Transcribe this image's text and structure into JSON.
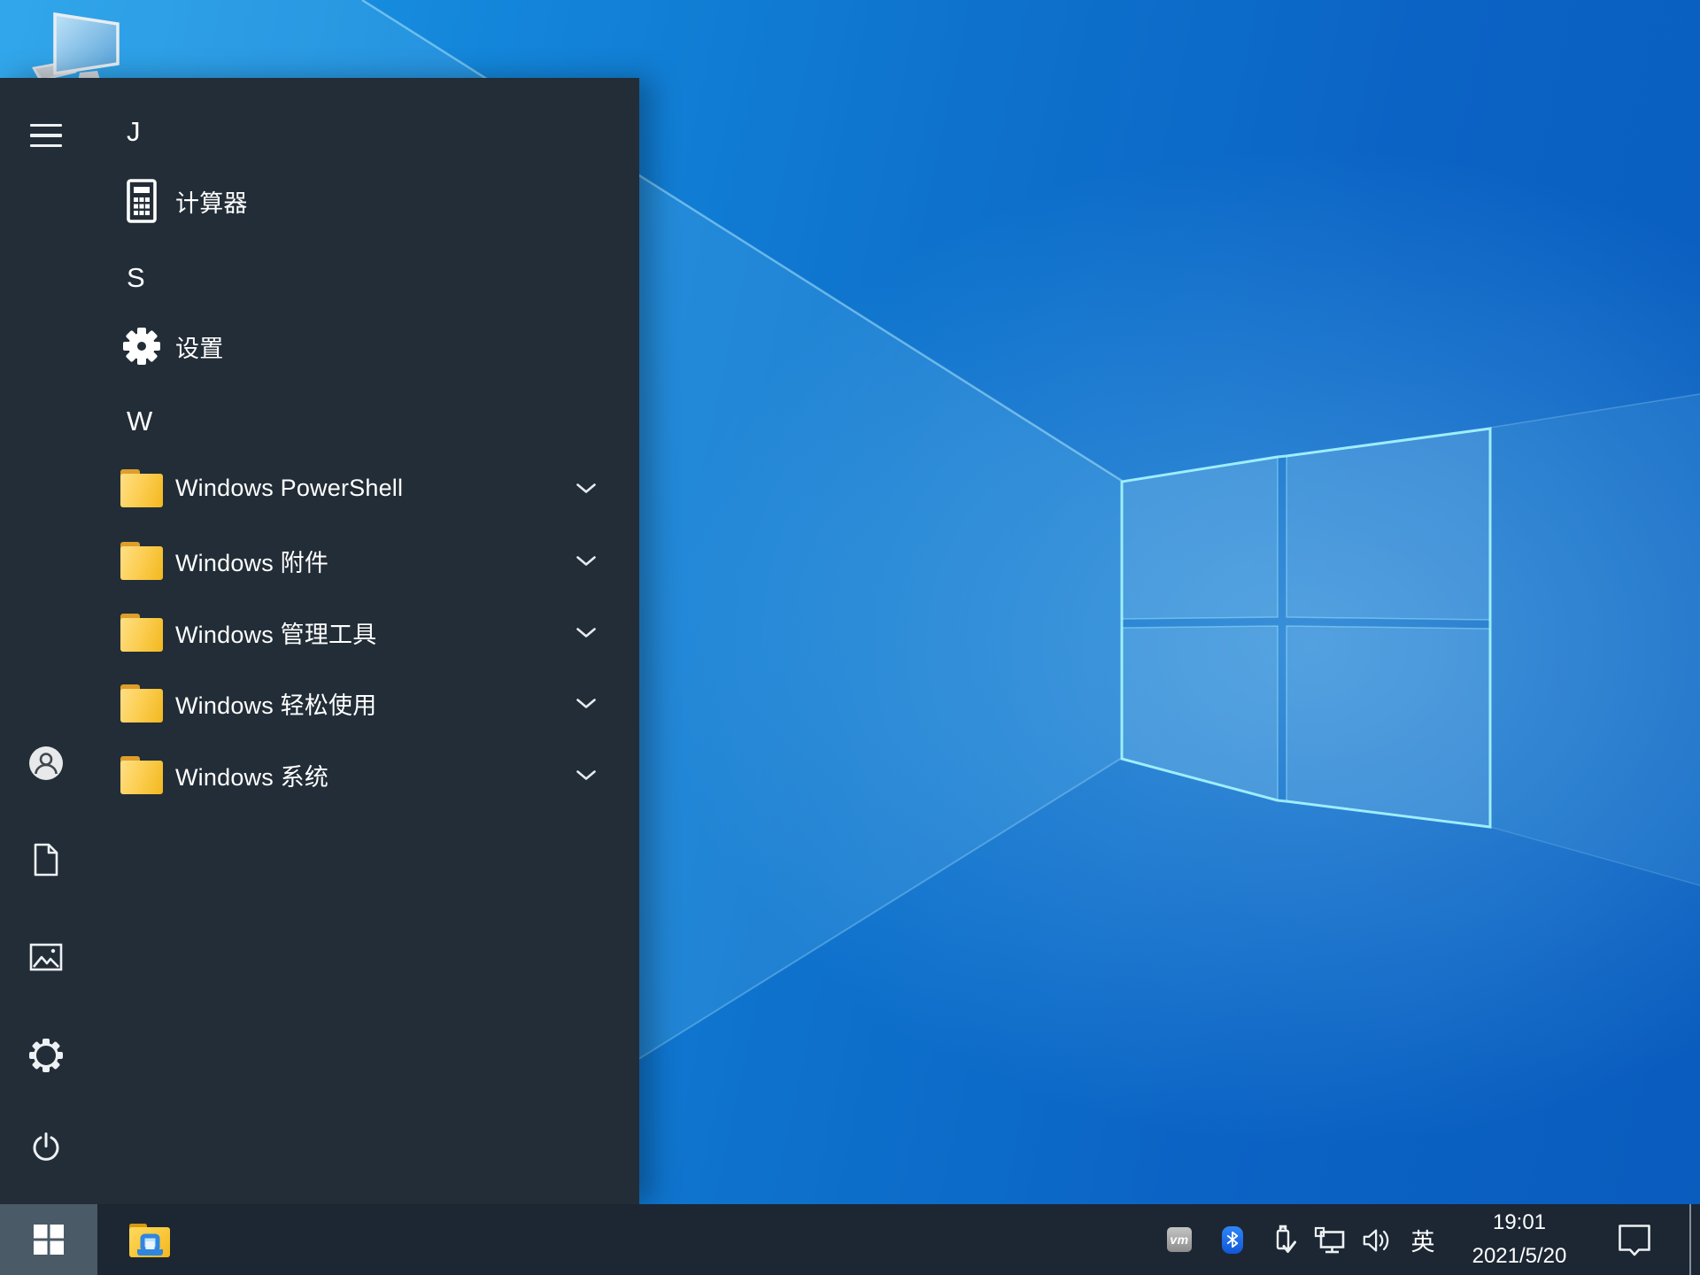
{
  "wallpaper": {
    "description": "windows-10-default-light-rays-logo",
    "base_blue": "#0d6cc8",
    "glow_blue": "#2aa3ea",
    "logo_edge_cyan": "#9df2ff"
  },
  "desktop": {
    "icons": [
      {
        "name": "this-pc",
        "label_visible": false
      }
    ]
  },
  "start_menu": {
    "background": "#222d37",
    "rail": {
      "hamburger": {
        "icon": "hamburger-icon"
      },
      "bottom_items": [
        {
          "name": "user",
          "icon": "user-icon"
        },
        {
          "name": "documents",
          "icon": "document-icon"
        },
        {
          "name": "pictures",
          "icon": "pictures-icon"
        },
        {
          "name": "settings",
          "icon": "gear-icon"
        },
        {
          "name": "power",
          "icon": "power-icon"
        }
      ]
    },
    "app_list": [
      {
        "type": "letter",
        "label": "J"
      },
      {
        "type": "app",
        "icon": "calculator-icon",
        "label": "计算器"
      },
      {
        "type": "letter",
        "label": "S"
      },
      {
        "type": "app",
        "icon": "gear-icon",
        "label": "设置"
      },
      {
        "type": "letter",
        "label": "W"
      },
      {
        "type": "folder",
        "icon": "folder-icon",
        "label": "Windows PowerShell",
        "expander": "chevron-down-icon"
      },
      {
        "type": "folder",
        "icon": "folder-icon",
        "label": "Windows 附件",
        "expander": "chevron-down-icon"
      },
      {
        "type": "folder",
        "icon": "folder-icon",
        "label": "Windows 管理工具",
        "expander": "chevron-down-icon"
      },
      {
        "type": "folder",
        "icon": "folder-icon",
        "label": "Windows 轻松使用",
        "expander": "chevron-down-icon"
      },
      {
        "type": "folder",
        "icon": "folder-icon",
        "label": "Windows 系统",
        "expander": "chevron-down-icon"
      }
    ]
  },
  "taskbar": {
    "background": "#1c2733",
    "start_button": {
      "icon": "windows-logo-icon",
      "active": true,
      "highlight": "#4a5a66"
    },
    "pinned": [
      {
        "name": "file-explorer",
        "icon": "file-explorer-icon"
      }
    ],
    "tray": {
      "vmware_label": "vm",
      "icons": [
        {
          "name": "vmware-tools"
        },
        {
          "name": "bluetooth"
        },
        {
          "name": "usb-safely-remove"
        },
        {
          "name": "network"
        },
        {
          "name": "volume"
        }
      ],
      "language_indicator": "英",
      "clock": {
        "time": "19:01",
        "date": "2021/5/20"
      },
      "action_center": {
        "icon": "action-center-icon"
      },
      "show_desktop": {
        "name": "show-desktop-strip"
      }
    }
  }
}
